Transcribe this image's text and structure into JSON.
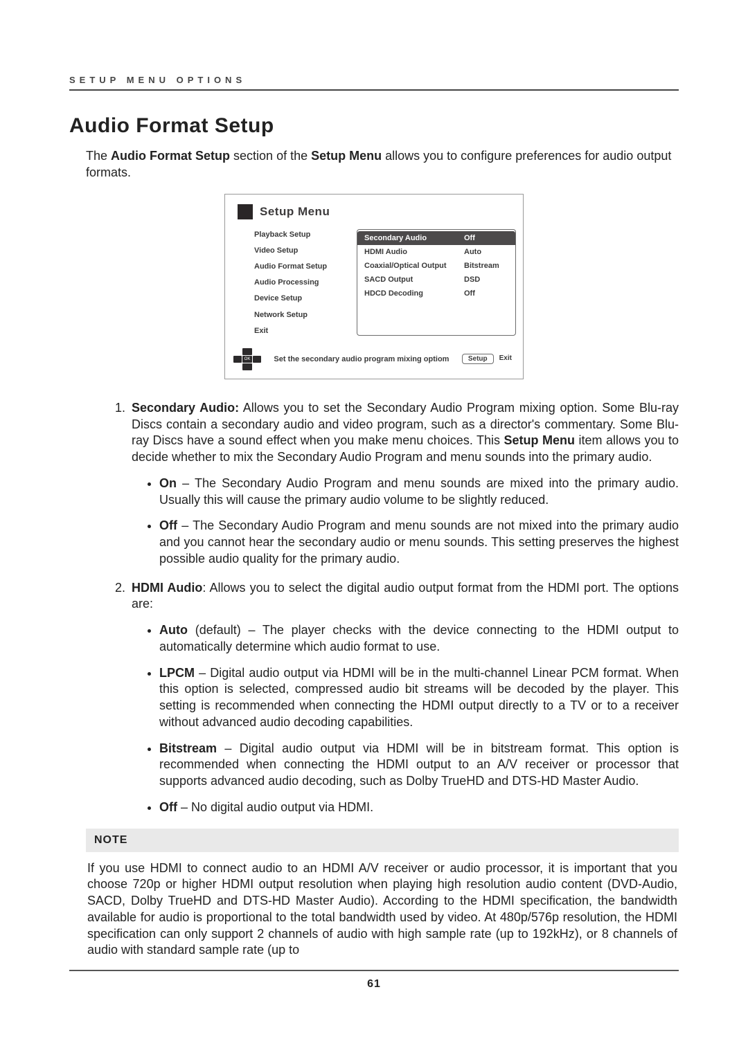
{
  "header": {
    "running_head": "SETUP MENU OPTIONS"
  },
  "title": "Audio Format Setup",
  "intro": {
    "pre": "The ",
    "b1": "Audio Format Setup",
    "mid": " section of the ",
    "b2": "Setup Menu",
    "post": " allows you to configure preferences for audio output formats."
  },
  "setup_menu": {
    "title": "Setup Menu",
    "nav": [
      "Playback Setup",
      "Video Setup",
      "Audio Format Setup",
      "Audio Processing",
      "Device Setup",
      "Network Setup",
      "Exit"
    ],
    "rows": [
      {
        "label": "Secondary Audio",
        "value": "Off",
        "selected": true
      },
      {
        "label": "HDMI Audio",
        "value": "Auto",
        "selected": false
      },
      {
        "label": "Coaxial/Optical Output",
        "value": "Bitstream",
        "selected": false
      },
      {
        "label": "SACD Output",
        "value": "DSD",
        "selected": false
      },
      {
        "label": "HDCD Decoding",
        "value": "Off",
        "selected": false
      }
    ],
    "dpad_center": "OK",
    "hint": "Set the secondary audio program mixing optiom",
    "button_setup": "Setup",
    "button_exit": "Exit"
  },
  "items": [
    {
      "lead_b": "Secondary Audio:",
      "lead_rest": " Allows you to set the Secondary Audio Program mixing option. Some Blu-ray Discs contain a secondary audio and video program, such as a director's commentary.  Some Blu-ray Discs have a sound effect when you make menu choices. This ",
      "lead_b2": "Setup Menu",
      "lead_rest2": " item allows you to decide whether to mix the Secondary Audio Program and menu sounds into the primary audio.",
      "bullets": [
        {
          "b": "On",
          "rest": " – The Secondary Audio Program and menu sounds are mixed into the primary audio. Usually this will cause the primary audio volume to be slightly reduced."
        },
        {
          "b": "Off",
          "rest": " – The Secondary Audio Program and menu sounds are not mixed into the primary audio and you cannot hear the secondary audio or menu sounds. This setting preserves the highest possible audio quality for the primary audio."
        }
      ]
    },
    {
      "lead_b": "HDMI Audio",
      "lead_rest": ": Allows you to select the digital audio output format from the HDMI port. The options are:",
      "bullets": [
        {
          "b": "Auto",
          "rest": " (default) – The player checks with the device connecting to the HDMI output to automatically determine which audio format to use."
        },
        {
          "b": "LPCM",
          "rest": " – Digital audio output via HDMI will be in the multi-channel Linear PCM format. When this option is selected, compressed audio bit streams will be decoded by the player. This setting is recommended when connecting the HDMI output directly to a TV or to a receiver without advanced audio decoding capabilities."
        },
        {
          "b": "Bitstream",
          "rest": " – Digital audio output via HDMI will be in bitstream format. This option is recommended when connecting the HDMI output to an A/V receiver or processor that supports advanced audio decoding, such as Dolby TrueHD and DTS-HD Master Audio."
        },
        {
          "b": "Off",
          "rest": " – No digital audio output via HDMI."
        }
      ]
    }
  ],
  "note": {
    "head": "NOTE",
    "body": "If you use HDMI to connect audio to an HDMI A/V receiver or audio processor, it is important that you choose 720p or higher HDMI output resolution when playing high resolution audio content (DVD-Audio, SACD, Dolby TrueHD and DTS-HD Master Audio). According to the HDMI specification, the bandwidth available for audio is proportional to the total bandwidth used by video. At 480p/576p resolution, the HDMI specification can only support 2 channels of audio with high sample rate (up to 192kHz), or 8 channels of audio with standard sample rate (up to"
  },
  "page_number": "61"
}
